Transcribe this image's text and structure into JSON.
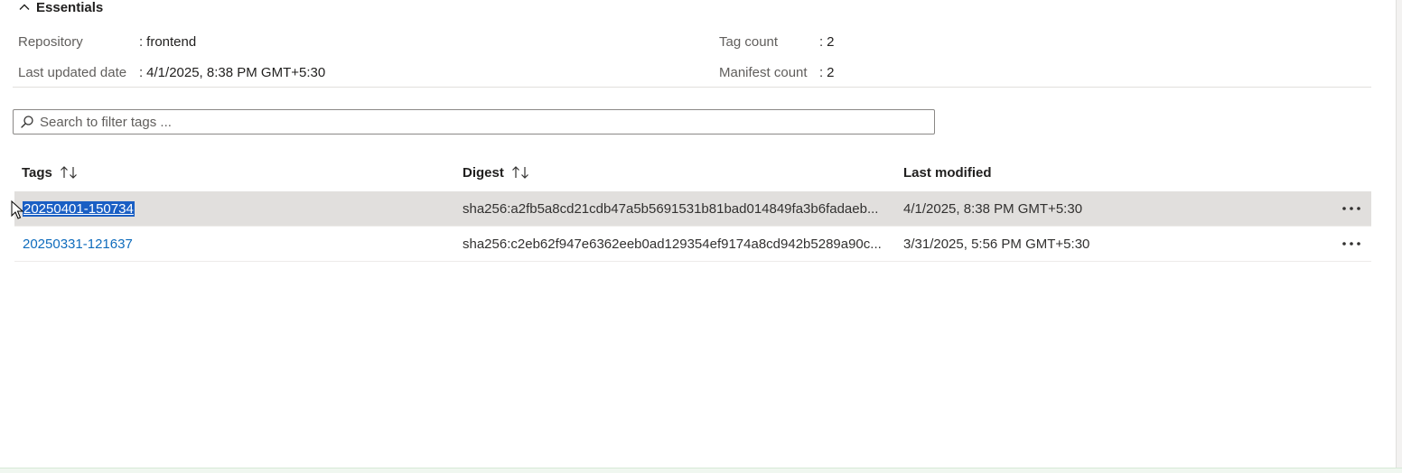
{
  "essentials": {
    "title": "Essentials",
    "repository_label": "Repository",
    "repository_value": "frontend",
    "last_updated_label": "Last updated date",
    "last_updated_value": "4/1/2025, 8:38 PM GMT+5:30",
    "tag_count_label": "Tag count",
    "tag_count_value": "2",
    "manifest_count_label": "Manifest count",
    "manifest_count_value": "2",
    "colon": ":"
  },
  "search": {
    "placeholder": "Search to filter tags ...",
    "value": ""
  },
  "table": {
    "headers": {
      "tags": "Tags",
      "digest": "Digest",
      "last_modified": "Last modified"
    },
    "rows": [
      {
        "tag": "20250401-150734",
        "digest": "sha256:a2fb5a8cd21cdb47a5b5691531b81bad014849fa3b6fadaeb...",
        "last_modified": "4/1/2025, 8:38 PM GMT+5:30",
        "selected": true
      },
      {
        "tag": "20250331-121637",
        "digest": "sha256:c2eb62f947e6362eeb0ad129354ef9174a8cd942b5289a90c...",
        "last_modified": "3/31/2025, 5:56 PM GMT+5:30",
        "selected": false
      }
    ]
  },
  "icons": {
    "essentials_toggle": "chevron-up-icon",
    "search": "search-icon",
    "sort": "sort-icon",
    "row_actions": "more-horizontal-icon"
  },
  "colors": {
    "link": "#0f6cbd",
    "selected_row": "#e1dfdd",
    "text_highlight": "#1a5fc4"
  }
}
